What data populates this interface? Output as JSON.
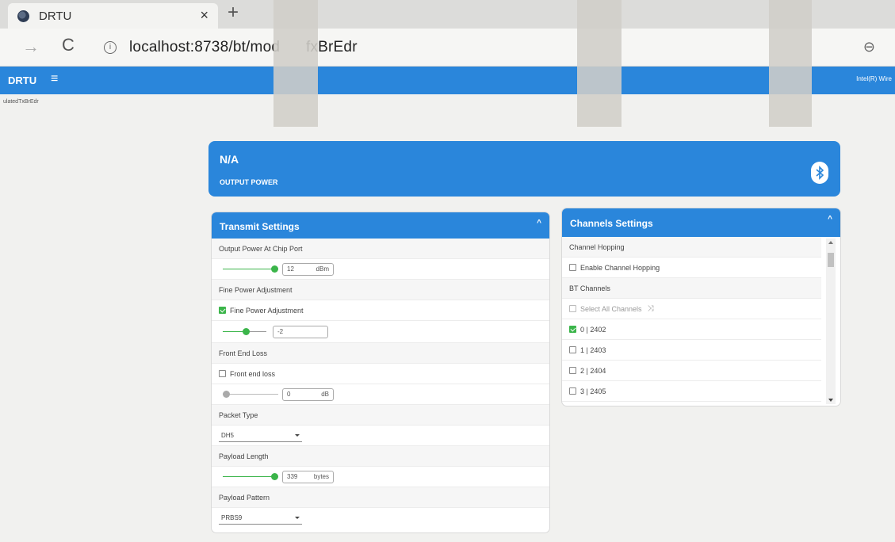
{
  "browser": {
    "tab_title": "DRTU",
    "tab_close": "×",
    "new_tab": "+",
    "forward": "→",
    "reload": "C",
    "info": "i",
    "url": "localhost:8738/bt/mod      fxBrEdr",
    "zoom": "⊖"
  },
  "app": {
    "brand": "DRTU",
    "menu": "≡",
    "header_right": "Intel(R) Wire",
    "breadcrumb": "ulatedTxBrEdr"
  },
  "status": {
    "value": "N/A",
    "label": "OUTPUT POWER"
  },
  "transmit": {
    "title": "Transmit Settings",
    "collapse": "^",
    "output_power_label": "Output Power At Chip Port",
    "output_power_value": "12",
    "output_power_unit": "dBm",
    "output_power_slider": 1.0,
    "fine_label": "Fine Power Adjustment",
    "fine_checkbox_label": "Fine Power Adjustment",
    "fine_checked": true,
    "fine_value": "-2",
    "fine_slider": 0.55,
    "front_label": "Front End Loss",
    "front_checkbox_label": "Front end loss",
    "front_checked": false,
    "front_value": "0",
    "front_unit": "dB",
    "front_slider": 0.0,
    "packet_label": "Packet Type",
    "packet_value": "DH5",
    "payload_len_label": "Payload Length",
    "payload_len_value": "339",
    "payload_len_unit": "bytes",
    "payload_len_slider": 1.0,
    "pattern_label": "Payload Pattern",
    "pattern_value": "PRBS9"
  },
  "channels": {
    "title": "Channels Settings",
    "collapse": "^",
    "hopping_label": "Channel Hopping",
    "hopping_checkbox_label": "Enable Channel Hopping",
    "bt_label": "BT Channels",
    "select_all_label": "Select All Channels",
    "shuffle_icon": "⤨",
    "items": [
      {
        "label": "0 | 2402",
        "checked": true
      },
      {
        "label": "1 | 2403",
        "checked": false
      },
      {
        "label": "2 | 2404",
        "checked": false
      },
      {
        "label": "3 | 2405",
        "checked": false
      }
    ]
  },
  "colors": {
    "accent": "#2a86db",
    "checked": "#3bb54a"
  }
}
